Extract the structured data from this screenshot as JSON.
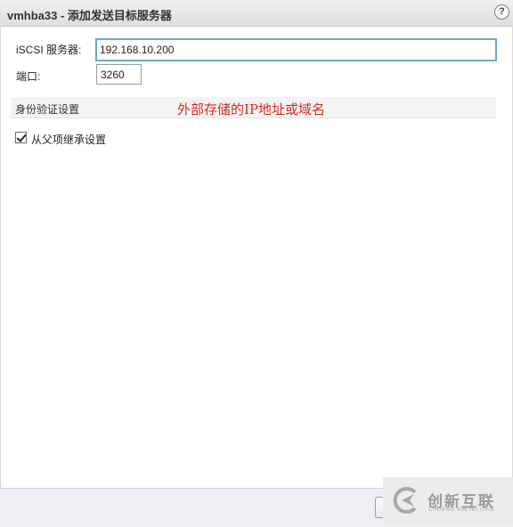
{
  "window": {
    "title": "vmhba33 - 添加发送目标服务器",
    "help_icon": "?"
  },
  "form": {
    "server_label": "iSCSI 服务器:",
    "server_value": "192.168.10.200",
    "port_label": "端口:",
    "port_value": "3260"
  },
  "auth": {
    "section_title": "身份验证设置",
    "inherit_label": "从父项继承设置",
    "inherit_checked": true
  },
  "annotation": {
    "text": "外部存储的IP地址或域名",
    "color": "#d52b1e"
  },
  "watermark": {
    "name": "创新互联",
    "sub": "CHUANG XIN HU LIAN"
  },
  "colors": {
    "focus_border": "#6ea8c7",
    "footer_bg": "#eeeef5"
  }
}
